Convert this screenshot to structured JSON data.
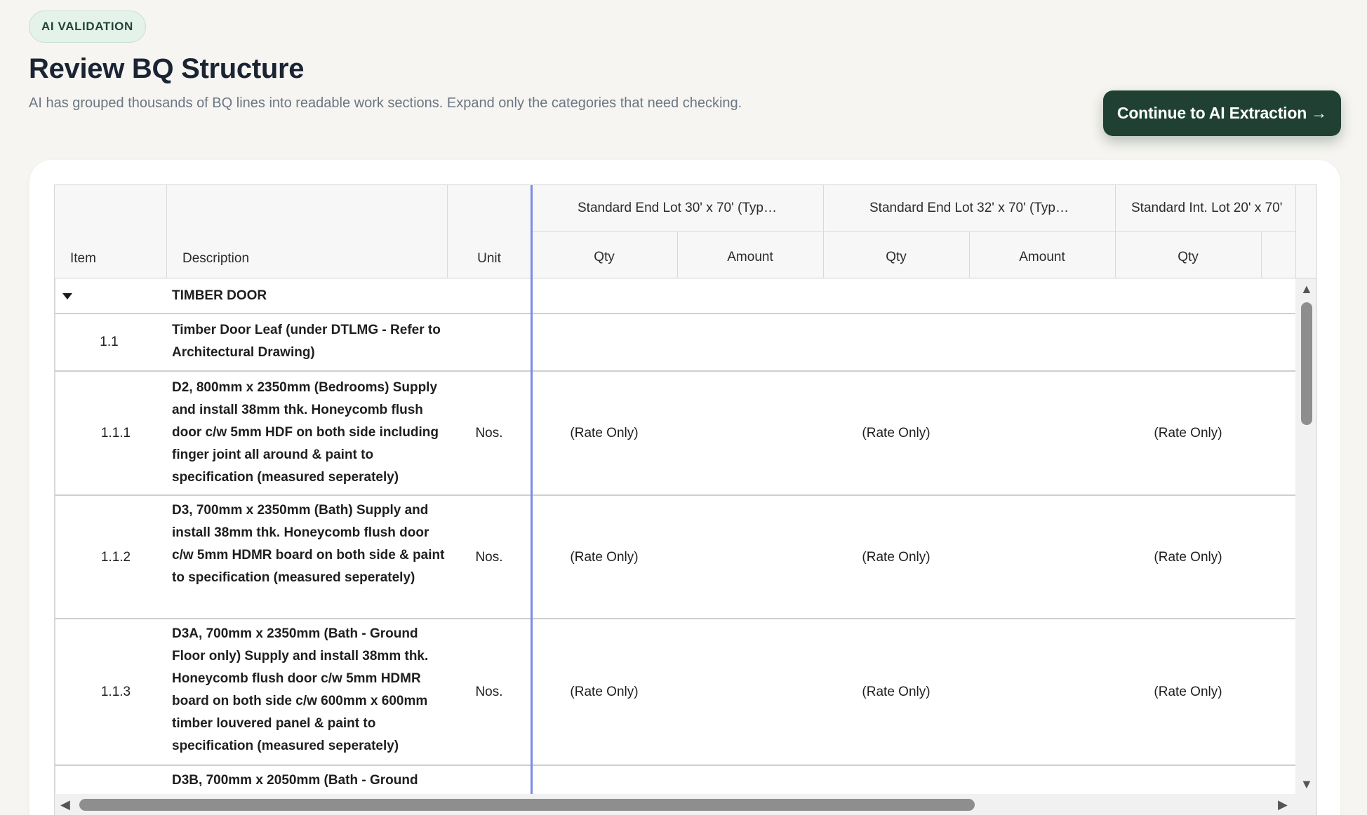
{
  "header": {
    "badge": "AI VALIDATION",
    "title": "Review BQ Structure",
    "subtitle": "AI has grouped thousands of BQ lines into readable work sections. Expand only the categories that need checking.",
    "cta_label": "Continue to AI Extraction →"
  },
  "table": {
    "columns": {
      "item": "Item",
      "description": "Description",
      "unit": "Unit",
      "groups": [
        "Standard End Lot 30' x 70' (Typ…",
        "Standard End Lot 32' x 70' (Typ…",
        "Standard Int. Lot 20' x 70'"
      ],
      "qty": "Qty",
      "amount": "Amount"
    },
    "section": {
      "title": "TIMBER DOOR",
      "expanded": true
    },
    "rows": [
      {
        "item": "1.1",
        "description": "Timber Door Leaf (under DTLMG - Refer to Architectural Drawing)",
        "unit": "",
        "values": [
          "",
          "",
          ""
        ]
      },
      {
        "item": "1.1.1",
        "description": "D2, 800mm x 2350mm (Bedrooms) Supply and install 38mm thk. Honeycomb flush door c/w 5mm HDF on both side including finger joint all around & paint to specification (measured seperately)",
        "unit": "Nos.",
        "values": [
          "(Rate Only)",
          "(Rate Only)",
          "(Rate Only)"
        ]
      },
      {
        "item": "1.1.2",
        "description": "D3, 700mm x 2350mm (Bath) Supply and install 38mm thk. Honeycomb flush door c/w 5mm HDMR board on both side & paint to specification (measured seperately)",
        "unit": "Nos.",
        "values": [
          "(Rate Only)",
          "(Rate Only)",
          "(Rate Only)"
        ]
      },
      {
        "item": "1.1.3",
        "description": "D3A, 700mm x 2350mm (Bath - Ground Floor only) Supply and install 38mm thk. Honeycomb flush door c/w 5mm HDMR board on both side c/w 600mm x 600mm timber louvered panel & paint to specification (measured seperately)",
        "unit": "Nos.",
        "values": [
          "(Rate Only)",
          "(Rate Only)",
          "(Rate Only)"
        ]
      },
      {
        "item": "",
        "description": "D3B, 700mm x 2050mm (Bath - Ground",
        "unit": "",
        "values": [
          "",
          "",
          ""
        ]
      }
    ]
  }
}
